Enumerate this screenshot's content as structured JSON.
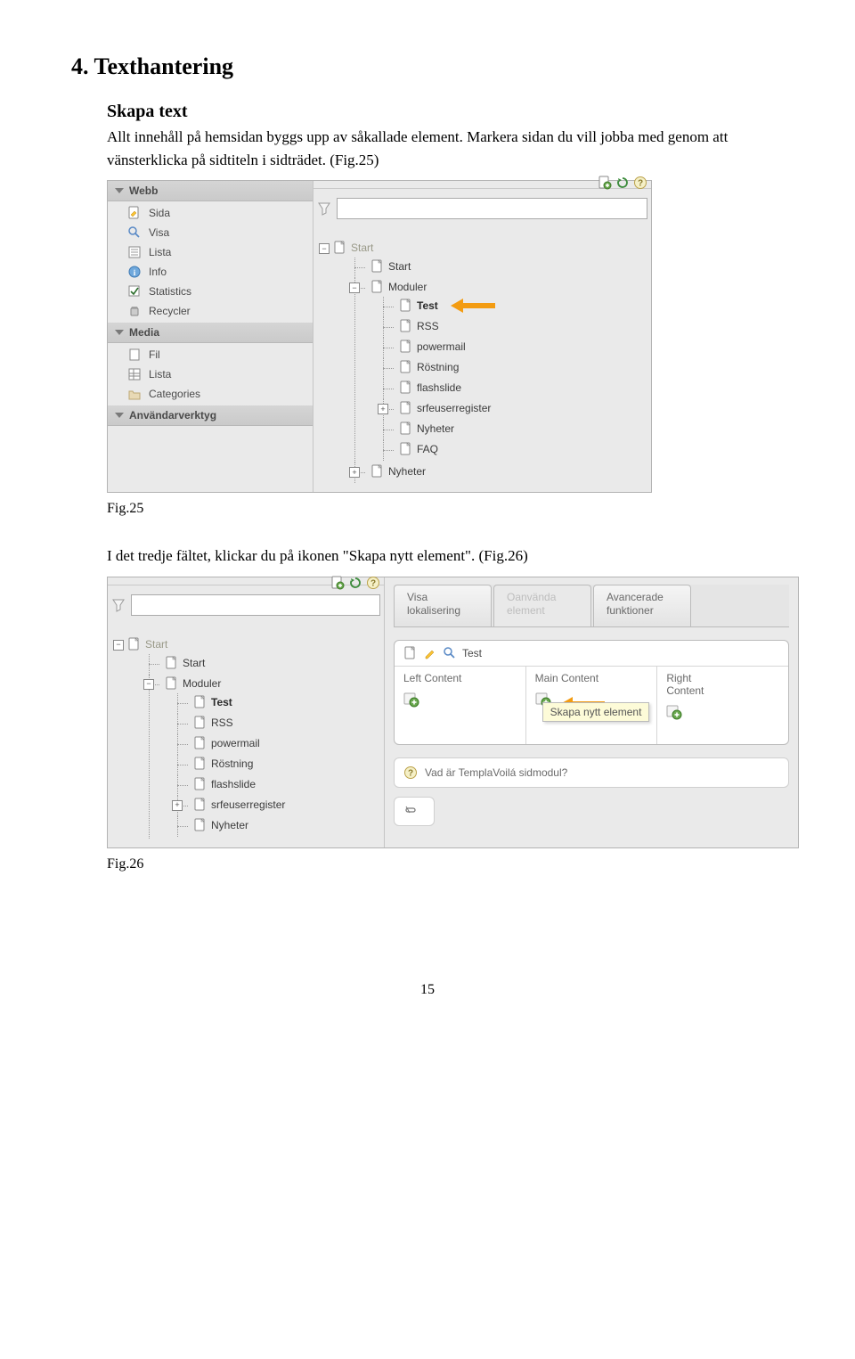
{
  "heading": "4. Texthantering",
  "section1": {
    "title": "Skapa text",
    "p1": "Allt innehåll på hemsidan byggs upp av såkallade element. Markera sidan du vill jobba med genom att vänsterklicka på sidtiteln i sidträdet. (Fig.25)"
  },
  "fig25": {
    "caption": "Fig.25",
    "left_panel": {
      "groups": [
        {
          "title": "Webb",
          "items": [
            {
              "label": "Sida",
              "icon": "page-edit-icon"
            },
            {
              "label": "Visa",
              "icon": "magnifier-icon"
            },
            {
              "label": "Lista",
              "icon": "list-icon"
            },
            {
              "label": "Info",
              "icon": "info-icon"
            },
            {
              "label": "Statistics",
              "icon": "checkbox-icon"
            },
            {
              "label": "Recycler",
              "icon": "recycler-icon"
            }
          ]
        },
        {
          "title": "Media",
          "items": [
            {
              "label": "Fil",
              "icon": "file-icon"
            },
            {
              "label": "Lista",
              "icon": "grid-icon"
            },
            {
              "label": "Categories",
              "icon": "folder-icon"
            }
          ]
        },
        {
          "title": "Användarverktyg",
          "items": []
        }
      ]
    },
    "tree": {
      "root_label": "Start",
      "nodes": [
        {
          "label": "Start"
        },
        {
          "label": "Moduler",
          "children": [
            {
              "label": "Test",
              "bold": true,
              "arrow": true
            },
            {
              "label": "RSS"
            },
            {
              "label": "powermail"
            },
            {
              "label": "Röstning"
            },
            {
              "label": "flashslide"
            },
            {
              "label": "srfeuserregister",
              "has_pm": "+"
            },
            {
              "label": "Nyheter"
            },
            {
              "label": "FAQ"
            }
          ]
        },
        {
          "label": "Nyheter",
          "has_pm": "+"
        }
      ]
    }
  },
  "section2": {
    "p1": "I det tredje fältet, klickar du på ikonen \"Skapa nytt element\". (Fig.26)"
  },
  "fig26": {
    "caption": "Fig.26",
    "tree": {
      "root_label": "Start",
      "nodes": [
        {
          "label": "Start"
        },
        {
          "label": "Moduler",
          "children": [
            {
              "label": "Test",
              "bold": true
            },
            {
              "label": "RSS"
            },
            {
              "label": "powermail"
            },
            {
              "label": "Röstning"
            },
            {
              "label": "flashslide"
            },
            {
              "label": "srfeuserregister",
              "has_pm": "+"
            },
            {
              "label": "Nyheter"
            }
          ]
        }
      ]
    },
    "tabs": [
      {
        "label_line1": "Visa",
        "label_line2": "lokalisering"
      },
      {
        "label_line1": "Oanvända",
        "label_line2": "element",
        "disabled": true
      },
      {
        "label_line1": "Avancerade",
        "label_line2": "funktioner"
      }
    ],
    "content": {
      "title": "Test",
      "columns": [
        {
          "label": "Left Content"
        },
        {
          "label": "Main Content",
          "arrow": true,
          "tooltip": "Skapa nytt element"
        },
        {
          "label_line1": "Right",
          "label_line2": "Content"
        }
      ]
    },
    "info_text": "Vad är TemplaVoilá sidmodul?"
  },
  "page_number": "15"
}
